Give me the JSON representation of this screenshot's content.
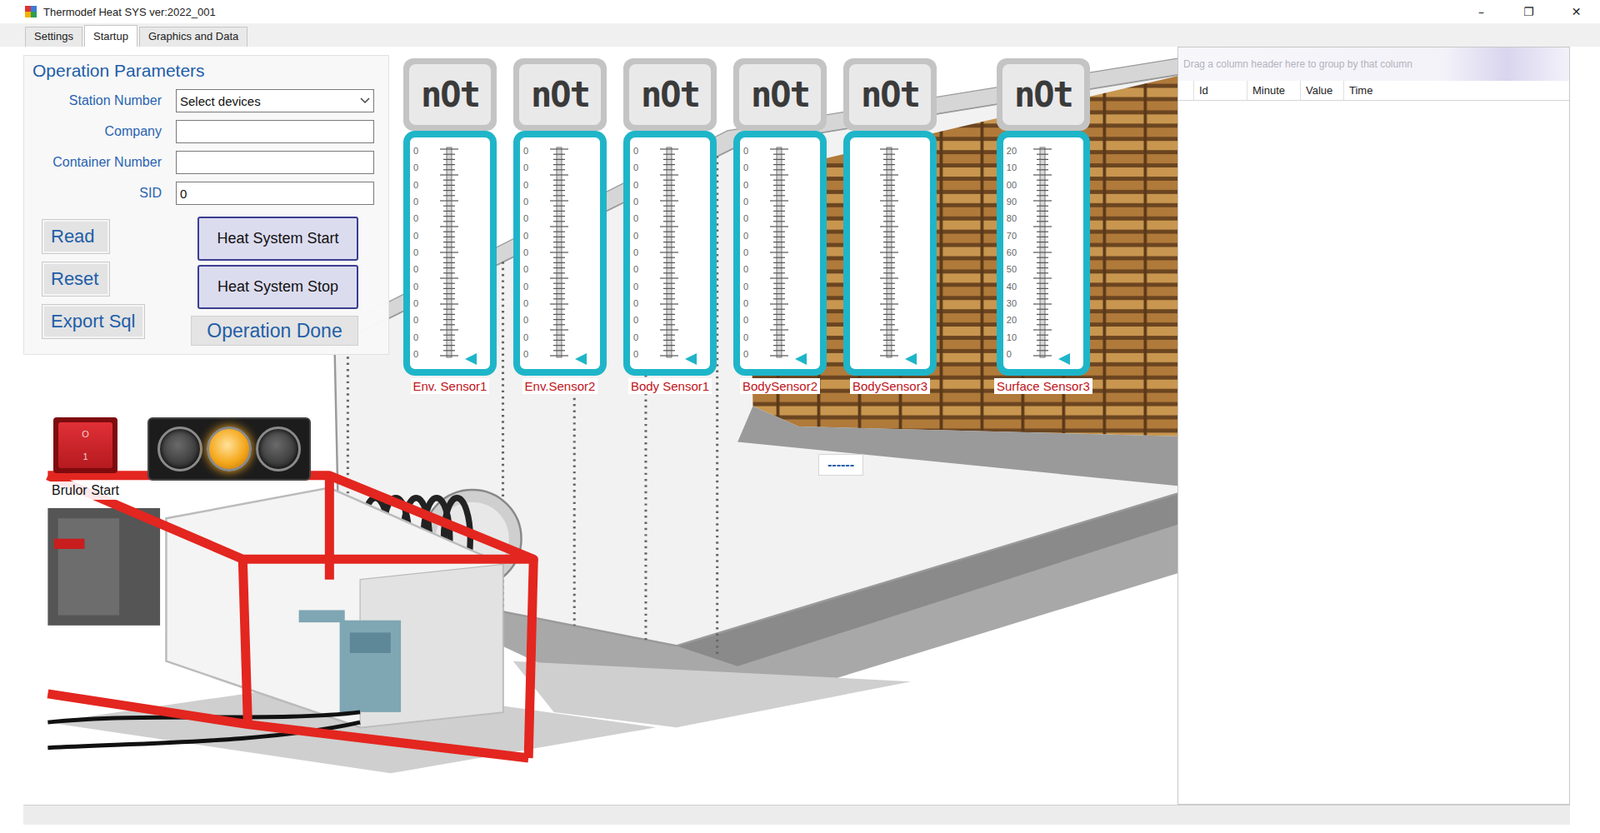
{
  "window": {
    "title": "Thermodef Heat SYS ver:2022_001",
    "controls": [
      "–",
      "❐",
      "✕"
    ]
  },
  "tabs": [
    {
      "label": "Settings",
      "selected": false
    },
    {
      "label": "Startup",
      "selected": true
    },
    {
      "label": "Graphics and Data",
      "selected": false
    }
  ],
  "operation_parameters": {
    "title": "Operation Parameters",
    "fields": [
      {
        "label": "Station Number",
        "kind": "select",
        "value": "Select devices"
      },
      {
        "label": "Company",
        "kind": "text",
        "value": ""
      },
      {
        "label": "Container Number",
        "kind": "text",
        "value": ""
      },
      {
        "label": "SID",
        "kind": "text",
        "value": "0"
      }
    ],
    "side_buttons": [
      "Read",
      "Reset",
      "Export Sql"
    ],
    "heat_buttons": [
      "Heat System Start",
      "Heat System Stop"
    ],
    "done_button": "Operation Done"
  },
  "sensors": [
    {
      "name": "Env. Sensor1",
      "display": "nOt",
      "scale": [
        "0",
        "0",
        "0",
        "0",
        "0",
        "0",
        "0",
        "0",
        "0",
        "0",
        "0",
        "0",
        "0"
      ],
      "level": 0
    },
    {
      "name": "Env.Sensor2",
      "display": "nOt",
      "scale": [
        "0",
        "0",
        "0",
        "0",
        "0",
        "0",
        "0",
        "0",
        "0",
        "0",
        "0",
        "0",
        "0"
      ],
      "level": 0
    },
    {
      "name": "Body Sensor1",
      "display": "nOt",
      "scale": [
        "0",
        "0",
        "0",
        "0",
        "0",
        "0",
        "0",
        "0",
        "0",
        "0",
        "0",
        "0",
        "0"
      ],
      "level": 0
    },
    {
      "name": "BodySensor2",
      "display": "nOt",
      "scale": [
        "0",
        "0",
        "0",
        "0",
        "0",
        "0",
        "0",
        "0",
        "0",
        "0",
        "0",
        "0",
        "0"
      ],
      "level": 0
    },
    {
      "name": "BodySensor3",
      "display": "nOt",
      "scale": [],
      "level": 0
    },
    {
      "name": "Surface Sensor3",
      "display": "nOt",
      "scale": [
        "20",
        "10",
        "00",
        "90",
        "80",
        "70",
        "60",
        "50",
        "40",
        "30",
        "20",
        "10",
        "0"
      ],
      "level": 0
    }
  ],
  "burner": {
    "label": "Brulor Start",
    "switch_symbols": [
      "O",
      "1"
    ],
    "lamps": [
      {
        "on": false,
        "color": "#3c3c3c"
      },
      {
        "on": true,
        "color": "#f5a81c"
      },
      {
        "on": false,
        "color": "#3c3c3c"
      }
    ]
  },
  "status_text": "------",
  "grid": {
    "group_hint": "Drag a column header here to group by that column",
    "columns": [
      "Id",
      "Minute",
      "Value",
      "Time"
    ],
    "rows": []
  }
}
